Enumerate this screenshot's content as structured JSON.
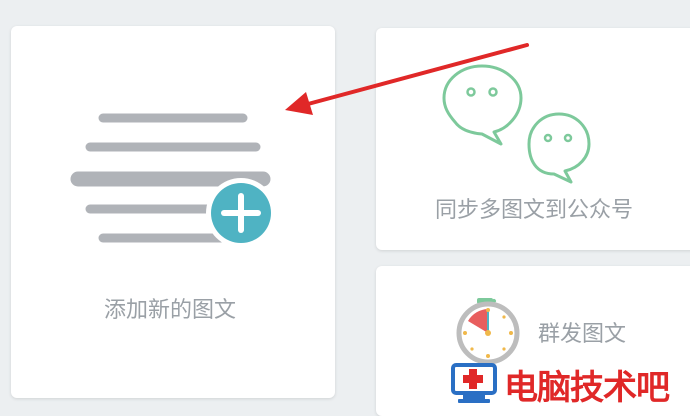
{
  "cards": {
    "add_new": {
      "label": "添加新的图文"
    },
    "sync": {
      "label": "同步多图文到公众号"
    },
    "mass_send": {
      "label": "群发图文"
    }
  },
  "watermark": {
    "text": "电脑技术吧"
  },
  "colors": {
    "page_bg": "#eceff1",
    "card_bg": "#ffffff",
    "line_gray": "#b0b3b8",
    "plus_teal": "#4fb3c3",
    "wechat_green": "#7dc99b",
    "arrow_red": "#e02828",
    "label_gray": "#9aa0a6"
  },
  "icons": [
    "document-lines-icon",
    "plus-circle-icon",
    "wechat-icon",
    "stopwatch-icon",
    "arrow-annotation",
    "computer-logo-icon"
  ]
}
